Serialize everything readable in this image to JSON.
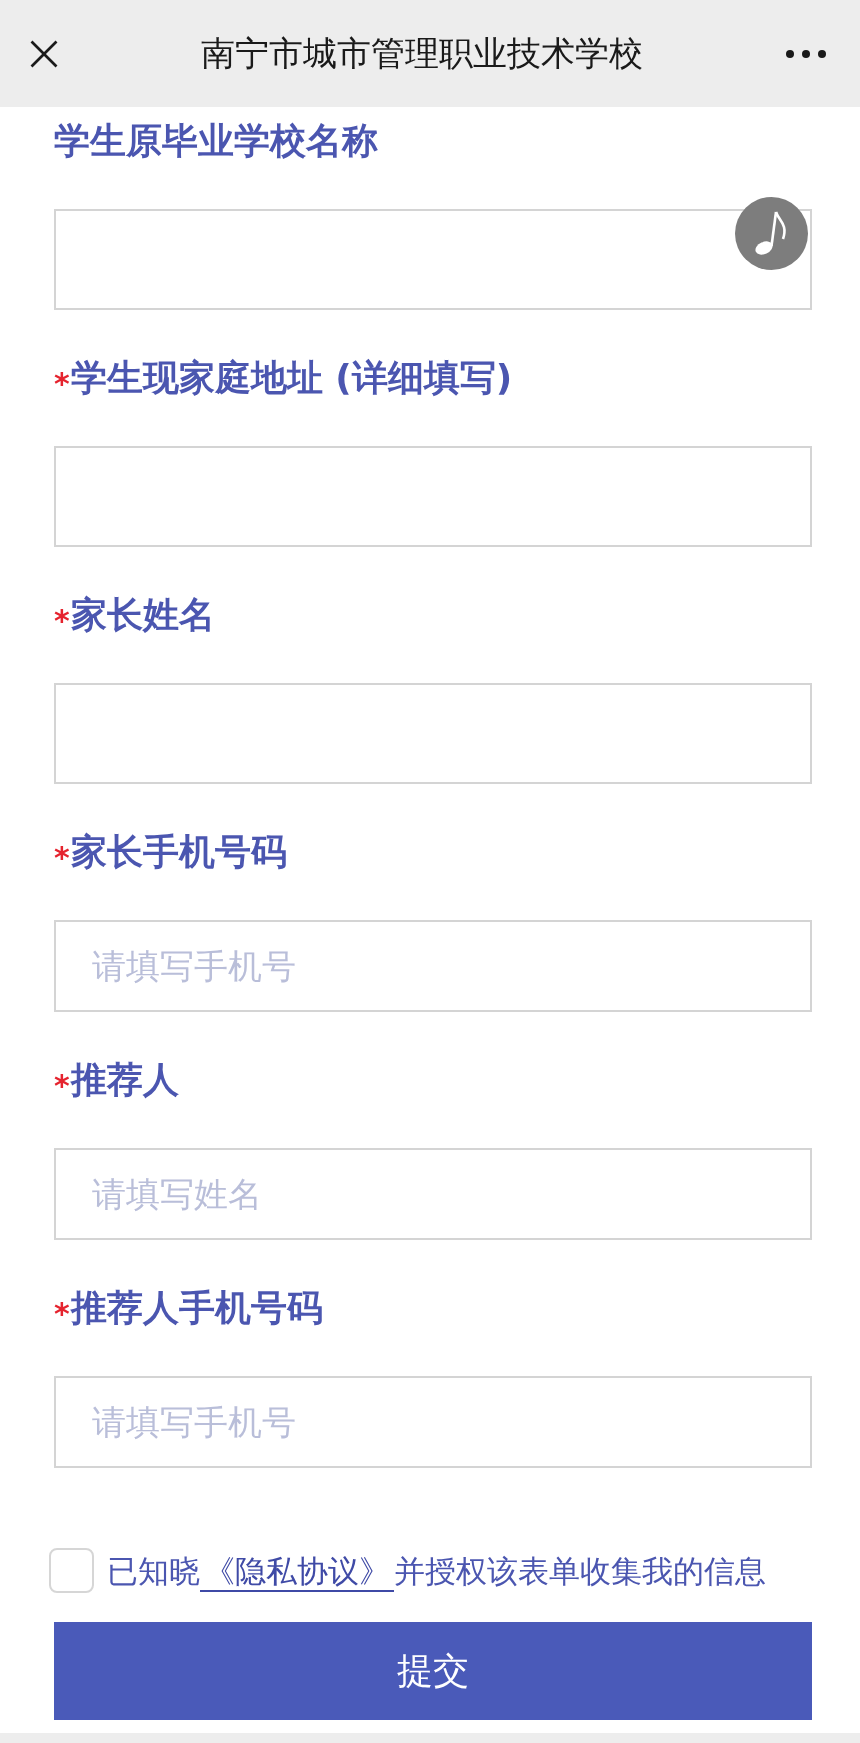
{
  "window": {
    "title": "南宁市城市管理职业技术学校"
  },
  "fields": [
    {
      "kind": "textarea",
      "label": "学生原毕业学校名称"
    },
    {
      "kind": "textarea",
      "marker": "*",
      "label": "学生现家庭地址 (详细填写)"
    },
    {
      "kind": "textarea",
      "marker": "*",
      "label": "家长姓名"
    },
    {
      "kind": "input",
      "marker": "*",
      "label": "家长手机号码",
      "placeholder": "请填写手机号"
    },
    {
      "kind": "input",
      "marker": "*",
      "label": "推荐人",
      "placeholder": "请填写姓名"
    },
    {
      "kind": "input",
      "marker": "*",
      "label": "推荐人手机号码",
      "placeholder": "请填写手机号"
    }
  ],
  "consent": {
    "checked": false,
    "text_before": "已知晓",
    "link": "《隐私协议》",
    "text_after": "并授权该表单收集我的信息"
  },
  "submit_button": "提交"
}
